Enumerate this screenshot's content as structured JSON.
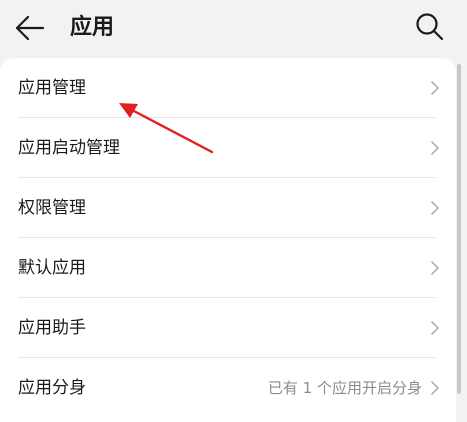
{
  "header": {
    "back_icon": "back-arrow-icon",
    "title": "应用",
    "search_icon": "search-icon"
  },
  "menu": {
    "items": [
      {
        "label": "应用管理",
        "value": "",
        "icon": "chevron-right-icon"
      },
      {
        "label": "应用启动管理",
        "value": "",
        "icon": "chevron-right-icon"
      },
      {
        "label": "权限管理",
        "value": "",
        "icon": "chevron-right-icon"
      },
      {
        "label": "默认应用",
        "value": "",
        "icon": "chevron-right-icon"
      },
      {
        "label": "应用助手",
        "value": "",
        "icon": "chevron-right-icon"
      },
      {
        "label": "应用分身",
        "value": "已有 1 个应用开启分身",
        "icon": "chevron-right-icon"
      }
    ]
  },
  "annotation": {
    "color": "#e02020",
    "points_to": "应用管理"
  },
  "colors": {
    "background": "#f2f2f2",
    "card": "#ffffff",
    "secondary_text": "#8c8c8c",
    "divider": "#e6e6e6"
  }
}
